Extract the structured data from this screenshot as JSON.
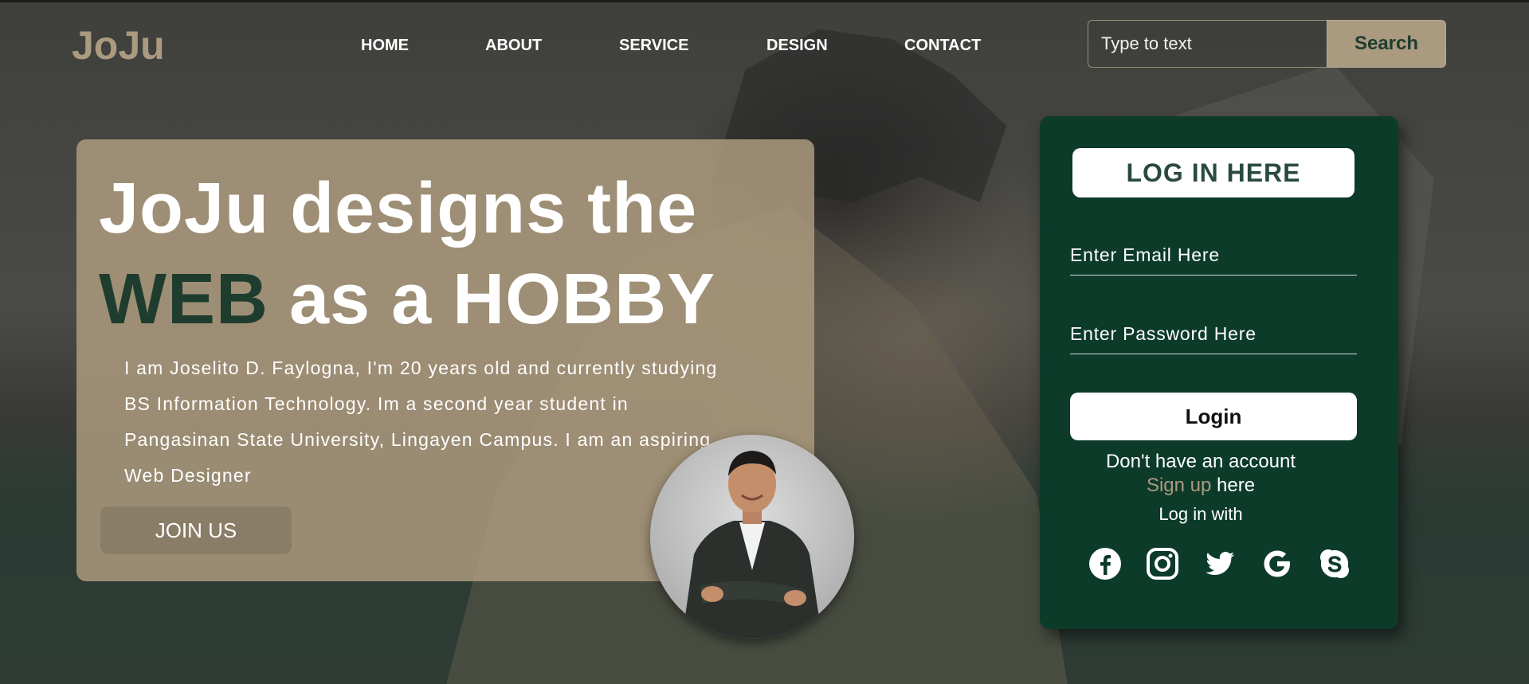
{
  "brand": {
    "logo": "JoJu"
  },
  "nav": {
    "items": [
      {
        "label": "HOME"
      },
      {
        "label": "ABOUT"
      },
      {
        "label": "SERVICE"
      },
      {
        "label": "DESIGN"
      },
      {
        "label": "CONTACT"
      }
    ]
  },
  "search": {
    "placeholder": "Type to text",
    "button_label": "Search"
  },
  "hero": {
    "headline_part1": "JoJu designs the",
    "headline_accent": "WEB",
    "headline_part2": " as a HOBBY",
    "description": "I am Joselito D. Faylogna, I'm 20 years old and currently studying BS Information Technology. Im a second year student in Pangasinan State University, Lingayen Campus. I am an aspiring Web Designer",
    "cta_label": "JOIN US"
  },
  "login": {
    "title": "LOG IN HERE",
    "email_placeholder": "Enter Email Here",
    "password_placeholder": "Enter Password Here",
    "button_label": "Login",
    "no_account_text": "Don't have an account",
    "signup_link": "Sign up",
    "signup_suffix": " here",
    "login_with_text": "Log in with",
    "socials": [
      "facebook-icon",
      "instagram-icon",
      "twitter-icon",
      "google-icon",
      "skype-icon"
    ]
  },
  "colors": {
    "accent_tan": "#a99a80",
    "accent_green": "#1f3d2e",
    "panel_green": "#0d3b2a"
  }
}
